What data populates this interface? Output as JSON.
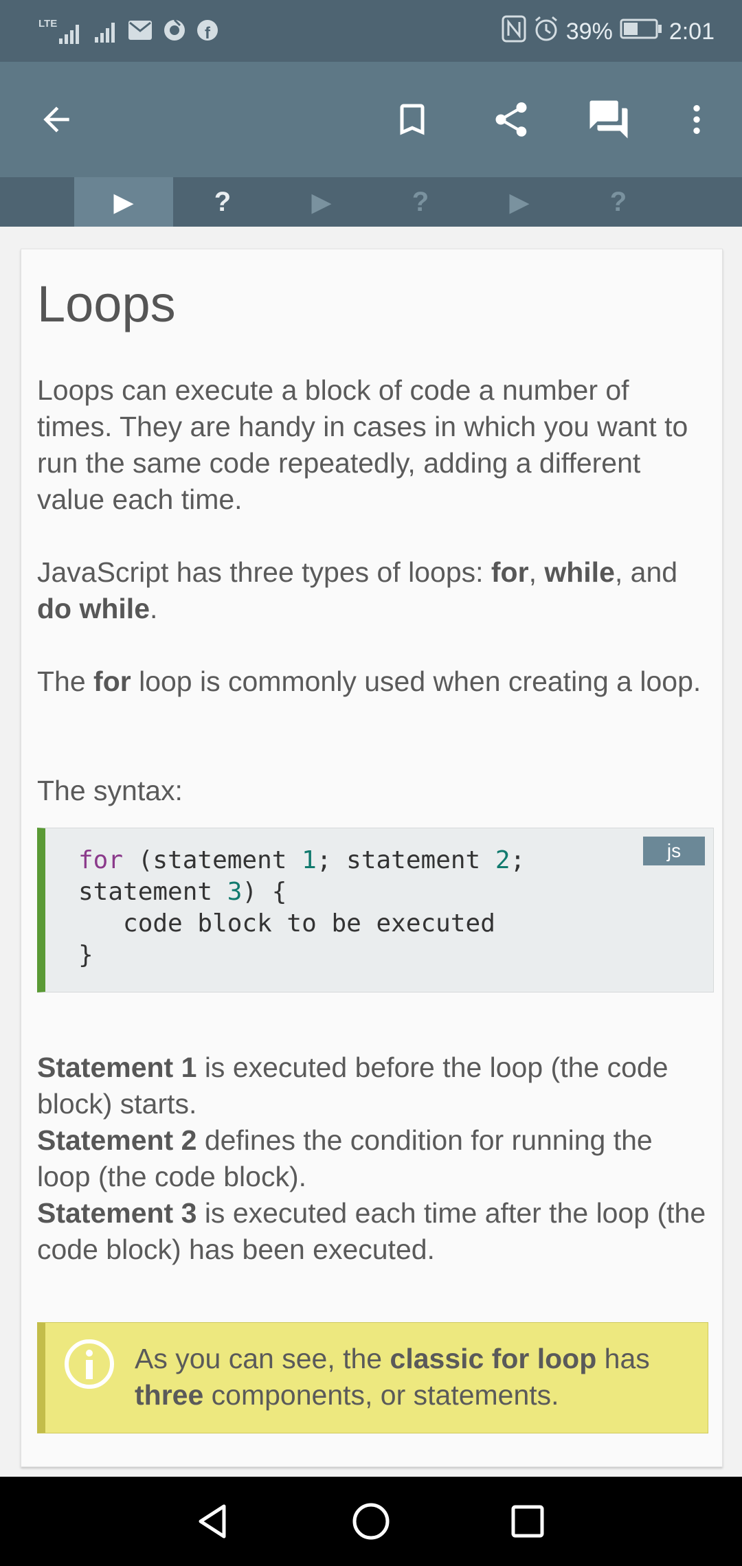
{
  "status_bar": {
    "network_label": "LTE",
    "battery": "39%",
    "time": "2:01"
  },
  "toolbar": {
    "back_icon": "arrow-back-icon",
    "bookmark_icon": "bookmark-icon",
    "share_icon": "share-icon",
    "comments_icon": "comments-icon",
    "more_icon": "more-vert-icon"
  },
  "steps": [
    {
      "type": "play",
      "glyph": "▶",
      "active": true
    },
    {
      "type": "quiz",
      "glyph": "?",
      "active": false
    },
    {
      "type": "play",
      "glyph": "▶",
      "active": false
    },
    {
      "type": "quiz",
      "glyph": "?",
      "active": false
    },
    {
      "type": "play",
      "glyph": "▶",
      "active": false
    },
    {
      "type": "quiz",
      "glyph": "?",
      "active": false
    }
  ],
  "lesson": {
    "title": "Loops",
    "intro": "Loops can execute a block of code a number of times. They are handy in cases in which you want to run the same code repeatedly, adding a different value each time.",
    "types_prefix": "JavaScript has three types of loops: ",
    "types_for": "for",
    "types_sep1": ", ",
    "types_while": "while",
    "types_sep2": ", and ",
    "types_dowhile": "do while",
    "types_end": ".",
    "for_prefix": "The ",
    "for_word": "for",
    "for_suffix": " loop is commonly used when creating a loop.",
    "syntax_label": "The syntax:",
    "code": {
      "lang": "js",
      "kw_for": "for",
      "l1_a": " (statement ",
      "n1": "1",
      "l1_b": "; statement ",
      "n2": "2",
      "l1_c": ";",
      "l2_a": "statement ",
      "n3": "3",
      "l2_b": ") {",
      "l3": "   code block to be executed",
      "l4": "}"
    },
    "s1_label": "Statement 1",
    "s1_text": " is executed before the loop (the code block) starts.",
    "s2_label": "Statement 2",
    "s2_text": " defines the condition for running the loop (the code block).",
    "s3_label": "Statement 3",
    "s3_text": " is executed each time after the loop (the code block) has been executed.",
    "tip": {
      "icon": "info-icon",
      "prefix": "As you can see, the ",
      "bold1": "classic for loop",
      "middle": " has ",
      "bold2": "three",
      "suffix": " components, or statements."
    }
  },
  "nav": {
    "back_icon": "nav-back-icon",
    "home_icon": "nav-home-icon",
    "recents_icon": "nav-recents-icon"
  },
  "colors": {
    "status_bar": "#4e6472",
    "app_bar": "#5e7886",
    "code_accent": "#5a9a35",
    "tip_background": "#ede87f"
  }
}
